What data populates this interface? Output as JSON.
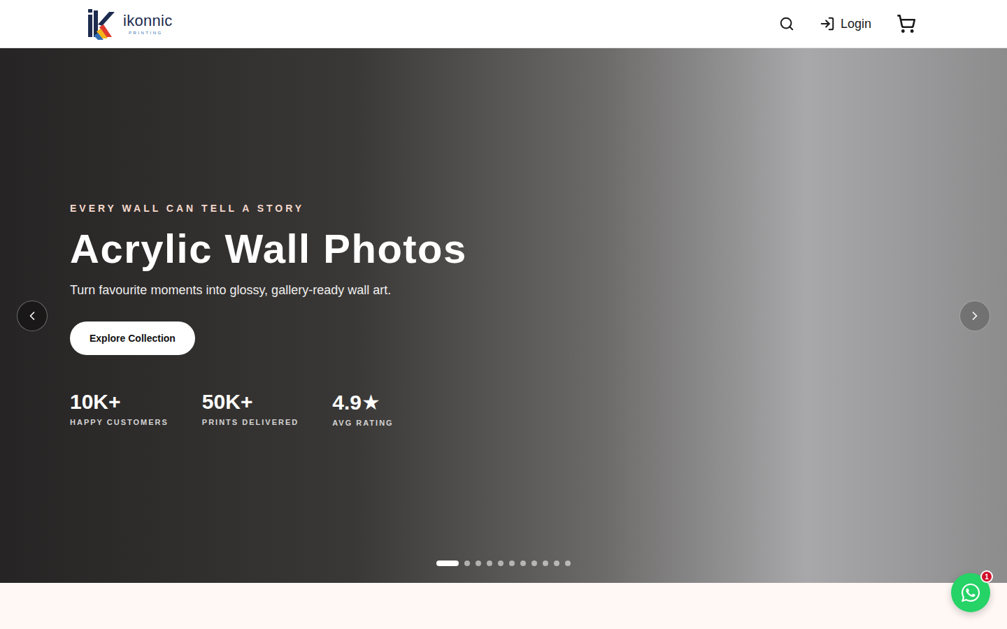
{
  "header": {
    "logo": {
      "name": "ikonnic",
      "tagline": "PRINTING"
    },
    "login": "Login"
  },
  "hero": {
    "eyebrow": "EVERY WALL CAN TELL A STORY",
    "title": "Acrylic Wall Photos",
    "subtitle": "Turn favourite moments into glossy, gallery-ready wall art.",
    "cta": "Explore Collection",
    "stats": [
      {
        "value": "10K+",
        "label": "HAPPY CUSTOMERS"
      },
      {
        "value": "50K+",
        "label": "PRINTS DELIVERED"
      },
      {
        "value": "4.9★",
        "label": "AVG RATING"
      }
    ],
    "slides": [
      {
        "selected": true
      },
      {
        "selected": false
      },
      {
        "selected": false
      },
      {
        "selected": false
      },
      {
        "selected": false
      },
      {
        "selected": false
      },
      {
        "selected": false
      },
      {
        "selected": false
      },
      {
        "selected": false
      },
      {
        "selected": false
      },
      {
        "selected": false
      }
    ]
  },
  "chat": {
    "badge": "1"
  }
}
